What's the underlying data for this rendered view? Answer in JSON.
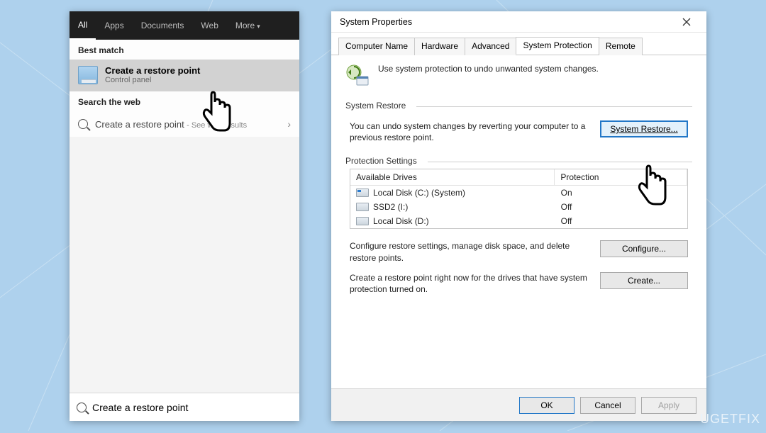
{
  "search": {
    "tabs": [
      "All",
      "Apps",
      "Documents",
      "Web",
      "More"
    ],
    "sections": {
      "best_match": "Best match",
      "search_web": "Search the web"
    },
    "best_match": {
      "title": "Create a restore point",
      "subtitle": "Control panel"
    },
    "web_result": {
      "title": "Create a restore point",
      "subtitle": "See web results"
    },
    "input_value": "Create a restore point"
  },
  "dialog": {
    "title": "System Properties",
    "tabs": [
      "Computer Name",
      "Hardware",
      "Advanced",
      "System Protection",
      "Remote"
    ],
    "active_tab": 3,
    "intro": "Use system protection to undo unwanted system changes.",
    "restore": {
      "legend": "System Restore",
      "desc": "You can undo system changes by reverting your computer to a previous restore point.",
      "button": "System Restore..."
    },
    "protection": {
      "legend": "Protection Settings",
      "headers": {
        "drive": "Available Drives",
        "protection": "Protection"
      },
      "drives": [
        {
          "name": "Local Disk (C:) (System)",
          "protection": "On"
        },
        {
          "name": "SSD2 (I:)",
          "protection": "Off"
        },
        {
          "name": "Local Disk (D:)",
          "protection": "Off"
        }
      ],
      "configure_desc": "Configure restore settings, manage disk space, and delete restore points.",
      "configure_btn": "Configure...",
      "create_desc": "Create a restore point right now for the drives that have system protection turned on.",
      "create_btn": "Create..."
    },
    "footer": {
      "ok": "OK",
      "cancel": "Cancel",
      "apply": "Apply"
    }
  },
  "watermark": "UGETFIX"
}
